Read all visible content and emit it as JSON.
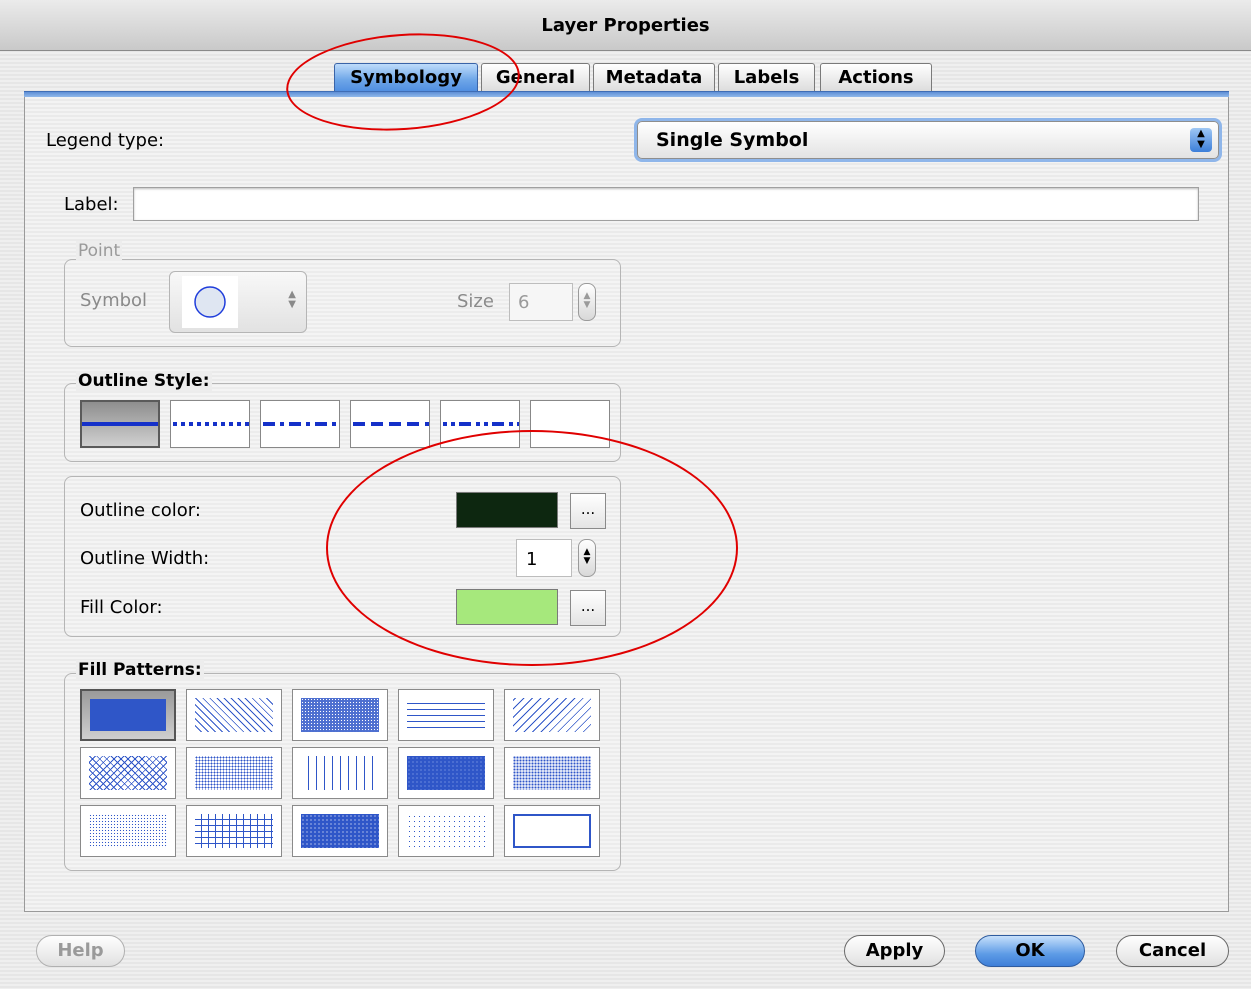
{
  "window": {
    "title": "Layer Properties"
  },
  "tabs": [
    {
      "label": "Symbology",
      "active": true
    },
    {
      "label": "General",
      "active": false
    },
    {
      "label": "Metadata",
      "active": false
    },
    {
      "label": "Labels",
      "active": false
    },
    {
      "label": "Actions",
      "active": false
    }
  ],
  "legend_type": {
    "label": "Legend type:",
    "value": "Single Symbol"
  },
  "label_field": {
    "label": "Label:",
    "value": ""
  },
  "point_group": {
    "title": "Point",
    "symbol_label": "Symbol",
    "symbol_icon": "circle-symbol-icon",
    "size_label": "Size",
    "size_value": "6"
  },
  "outline_style": {
    "title": "Outline Style:",
    "options": [
      "solid",
      "dotted",
      "dash-dot",
      "dashed",
      "dash-dot-dot",
      "none"
    ],
    "selected": "solid"
  },
  "colors": {
    "outline_color_label": "Outline color:",
    "outline_color": "#0d2710",
    "outline_width_label": "Outline Width:",
    "outline_width_value": "1",
    "fill_color_label": "Fill Color:",
    "fill_color": "#a6e87c",
    "picker_label": "..."
  },
  "fill_patterns": {
    "title": "Fill Patterns:",
    "options": [
      "solid",
      "b-diagonal",
      "dense-1",
      "horizontal",
      "f-diagonal",
      "cross-diagonal",
      "dense-4",
      "vertical",
      "dense-2",
      "dense-3",
      "dense-6",
      "cross",
      "dense-3b",
      "dense-7",
      "no-brush"
    ],
    "selected": "solid",
    "pattern_color": "#2f56c8"
  },
  "buttons": {
    "help": "Help",
    "apply": "Apply",
    "ok": "OK",
    "cancel": "Cancel"
  }
}
